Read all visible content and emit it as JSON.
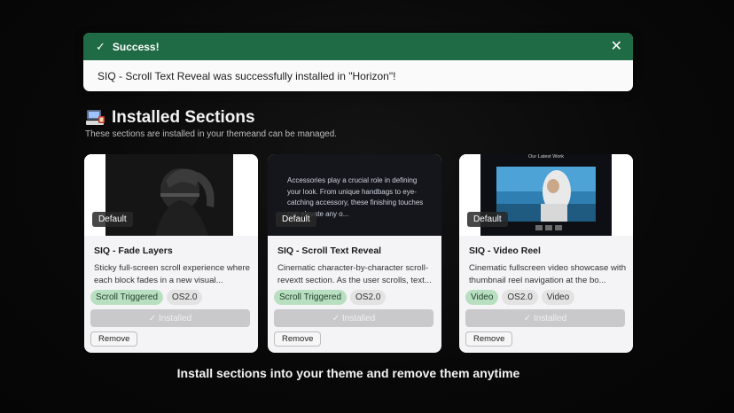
{
  "toast": {
    "title": "Success!",
    "message": "SIQ - Scroll Text Reveal was successfully installed in \"Horizon\"!",
    "check_icon": "✓",
    "close_icon": "✕",
    "accent": "#1f6b45"
  },
  "section": {
    "title": "Installed Sections",
    "subtitle": "These sections are installed in your themeand can be managed."
  },
  "cards": [
    {
      "badge": "Default",
      "name": "SIQ - Fade Layers",
      "description": "Sticky full-screen scroll experience where each block fades in a new visual...",
      "tags": [
        {
          "label": "Scroll Triggered",
          "style": "green"
        },
        {
          "label": "OS2.0",
          "style": "grey"
        }
      ],
      "installed_label": "✓ Installed",
      "remove_label": "Remove"
    },
    {
      "badge": "Default",
      "name": "SIQ - Scroll Text Reveal",
      "description": "Cinematic character-by-character scroll-revextt section. As the user scrolls, text...",
      "thumb_text": "Accessories play a crucial role in defining your look. From unique handbags to eye-catching accessory, these finishing touches can elevate any o...",
      "tags": [
        {
          "label": "Scroll Triggered",
          "style": "green"
        },
        {
          "label": "OS2.0",
          "style": "grey"
        }
      ],
      "installed_label": "✓ Installed",
      "remove_label": "Remove"
    },
    {
      "badge": "Default",
      "name": "SIQ - Video Reel",
      "description": "Cinematic fullscreen video showcase with thumbnail reel navigation at the bo...",
      "thumb_heading": "Our Latest Work",
      "tags": [
        {
          "label": "Video",
          "style": "green"
        },
        {
          "label": "OS2.0",
          "style": "grey"
        },
        {
          "label": "Video",
          "style": "grey"
        }
      ],
      "installed_label": "✓ Installed",
      "remove_label": "Remove"
    }
  ],
  "caption": "Install sections into your theme and remove them anytime"
}
